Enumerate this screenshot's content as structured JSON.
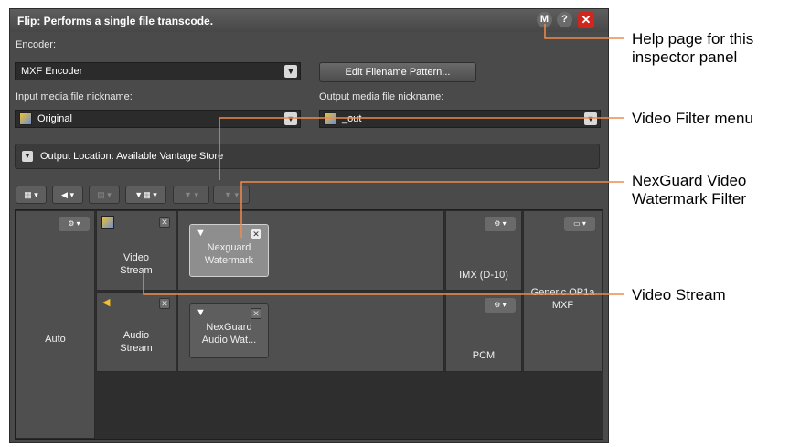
{
  "panel": {
    "title": "Flip: Performs a single file transcode.",
    "title_buttons": {
      "mode": "M",
      "help": "?",
      "close": "✕"
    },
    "encoder_label": "Encoder:",
    "encoder_value": "MXF Encoder",
    "edit_pattern_button": "Edit Filename Pattern...",
    "input_nickname_label": "Input media file nickname:",
    "input_nickname_value": "Original",
    "output_nickname_label": "Output media file nickname:",
    "output_nickname_value": "_out",
    "output_location": "Output Location: Available Vantage Store"
  },
  "grid": {
    "container_label": "Auto",
    "video_stream_label": "Video Stream",
    "audio_stream_label": "Audio Stream",
    "video_filter_label": "Nexguard Watermark",
    "audio_filter_label": "NexGuard Audio Wat...",
    "video_codec_label": "IMX (D-10)",
    "audio_codec_label": "PCM",
    "format_label": "Generic OP1a MXF"
  },
  "annotations": {
    "help_page": "Help page for this inspector panel",
    "video_filter_menu": "Video Filter menu",
    "nexguard_filter": "NexGuard Video Watermark Filter",
    "video_stream": "Video Stream"
  },
  "colors": {
    "panel_bg": "#4a4a4a",
    "close_red": "#d0261d",
    "annotation_line": "#f08a4b"
  }
}
